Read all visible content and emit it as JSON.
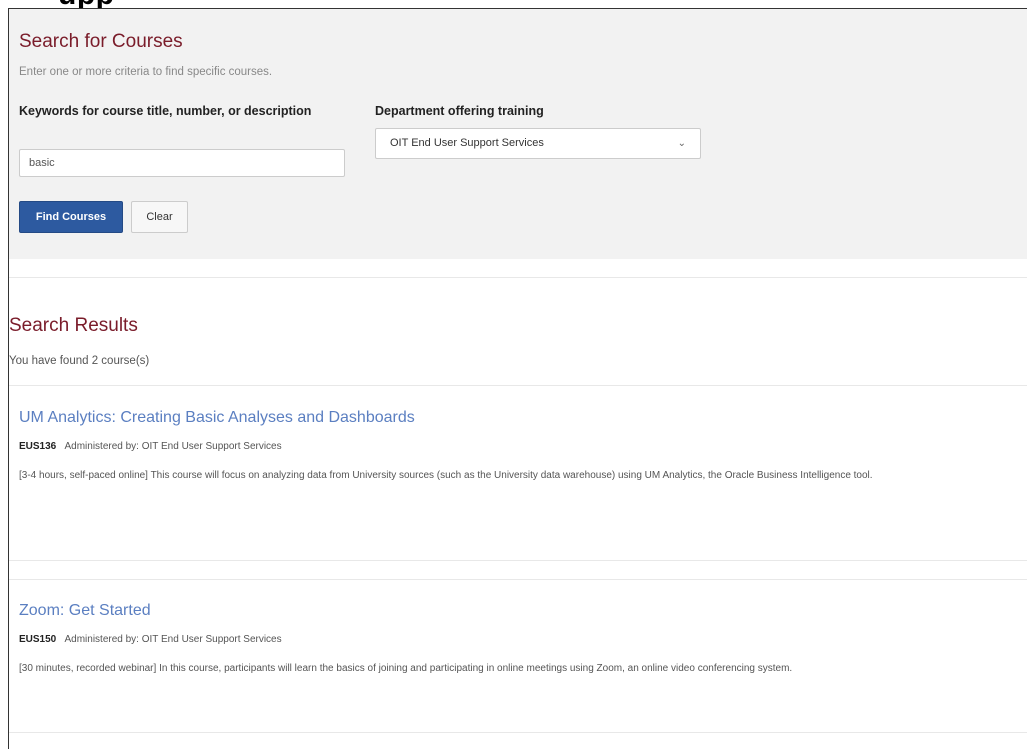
{
  "page": {
    "heading_fragment": "upp"
  },
  "search": {
    "title": "Search for Courses",
    "subtitle": "Enter one or more criteria to find specific courses.",
    "keywords_label": "Keywords for course title, number, or description",
    "keywords_value": "basic",
    "department_label": "Department offering training",
    "department_selected": "OIT End User Support Services",
    "find_button": "Find Courses",
    "clear_button": "Clear"
  },
  "results": {
    "title": "Search Results",
    "count_text": "You have found 2 course(s)",
    "courses": [
      {
        "title": "UM Analytics: Creating Basic Analyses and Dashboards",
        "code": "EUS136",
        "admin": "Administered by: OIT End User Support Services",
        "description": "[3-4 hours, self-paced online] This course will focus on analyzing data from University sources (such as the University data warehouse) using UM Analytics, the Oracle Business Intelligence tool."
      },
      {
        "title": "Zoom: Get Started",
        "code": "EUS150",
        "admin": "Administered by: OIT End User Support Services",
        "description": "[30 minutes, recorded webinar] In this course, participants will learn the basics of joining and participating in online meetings using Zoom, an online video conferencing system."
      }
    ]
  },
  "icons": {
    "select_chevron": "chevron-down-icon"
  },
  "colors": {
    "heading_maroon": "#7a1c2a",
    "link_blue": "#5b7fc1",
    "primary_button": "#2d5aa0",
    "panel_background": "#f2f2f2"
  }
}
